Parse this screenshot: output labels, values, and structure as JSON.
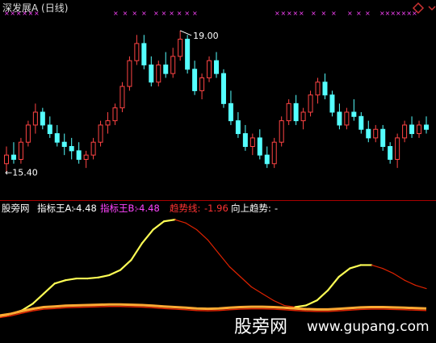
{
  "header": {
    "title": "深发展A (日线)",
    "icon": "diamond-icon",
    "icon_color": "#cc3333"
  },
  "price_panel": {
    "high_label": "19.00",
    "low_label": "←15.40"
  },
  "indicator_panel": {
    "name": "股旁网",
    "items": [
      {
        "label": "指标王A:",
        "value": "-4.48",
        "color": "#ffffff"
      },
      {
        "label": "指标王B:",
        "value": "-4.48",
        "color": "#ff44ff"
      },
      {
        "label": "趋势线:",
        "value": "-1.96",
        "color": "#ff3333"
      },
      {
        "label": "向上趋势:",
        "value": "-",
        "color": "#ffffff"
      }
    ]
  },
  "watermark": {
    "cn": "股旁网",
    "url": "www.gupang.com"
  },
  "colors": {
    "up": "#ff4444",
    "down": "#55ffff",
    "separator": "#aa0000",
    "marker": "#ff44ff",
    "yellow": "#ffff55",
    "red_line": "#dd2200",
    "orange": "#ffaa33"
  },
  "chart_data": {
    "type": "candlestick",
    "ylim": [
      15.2,
      19.3
    ],
    "candles": [
      [
        15.9,
        16.3,
        15.7,
        16.1
      ],
      [
        16.1,
        16.4,
        15.9,
        16.0
      ],
      [
        16.0,
        16.5,
        15.9,
        16.4
      ],
      [
        16.4,
        16.9,
        16.3,
        16.8
      ],
      [
        16.8,
        17.3,
        16.6,
        17.1
      ],
      [
        17.1,
        17.2,
        16.7,
        16.8
      ],
      [
        16.8,
        17.0,
        16.5,
        16.6
      ],
      [
        16.6,
        16.8,
        16.3,
        16.4
      ],
      [
        16.4,
        16.6,
        16.1,
        16.3
      ],
      [
        16.3,
        16.5,
        16.0,
        16.2
      ],
      [
        16.2,
        16.4,
        15.9,
        16.0
      ],
      [
        16.0,
        16.2,
        15.8,
        16.1
      ],
      [
        16.1,
        16.5,
        16.0,
        16.4
      ],
      [
        16.4,
        16.9,
        16.3,
        16.8
      ],
      [
        16.8,
        17.1,
        16.6,
        16.9
      ],
      [
        16.9,
        17.3,
        16.8,
        17.2
      ],
      [
        17.2,
        17.8,
        17.1,
        17.7
      ],
      [
        17.7,
        18.4,
        17.6,
        18.3
      ],
      [
        18.3,
        18.9,
        18.2,
        18.7
      ],
      [
        18.7,
        18.9,
        18.1,
        18.2
      ],
      [
        18.2,
        18.4,
        17.7,
        17.8
      ],
      [
        17.8,
        18.3,
        17.7,
        18.2
      ],
      [
        18.2,
        18.5,
        17.9,
        18.0
      ],
      [
        18.0,
        18.6,
        17.9,
        18.4
      ],
      [
        18.4,
        19.0,
        18.3,
        18.8
      ],
      [
        18.8,
        18.9,
        18.0,
        18.1
      ],
      [
        18.1,
        18.3,
        17.5,
        17.6
      ],
      [
        17.6,
        18.0,
        17.4,
        17.9
      ],
      [
        17.9,
        18.4,
        17.8,
        18.3
      ],
      [
        18.3,
        18.5,
        17.9,
        18.0
      ],
      [
        18.0,
        18.1,
        17.2,
        17.3
      ],
      [
        17.3,
        17.6,
        16.8,
        16.9
      ],
      [
        16.9,
        17.1,
        16.5,
        16.6
      ],
      [
        16.6,
        16.8,
        16.2,
        16.3
      ],
      [
        16.3,
        16.6,
        16.1,
        16.5
      ],
      [
        16.5,
        16.7,
        16.0,
        16.1
      ],
      [
        16.1,
        16.3,
        15.8,
        15.9
      ],
      [
        15.9,
        16.5,
        15.8,
        16.4
      ],
      [
        16.4,
        17.0,
        16.3,
        16.9
      ],
      [
        16.9,
        17.4,
        16.8,
        17.3
      ],
      [
        17.3,
        17.5,
        16.8,
        16.9
      ],
      [
        16.9,
        17.2,
        16.7,
        17.1
      ],
      [
        17.1,
        17.6,
        17.0,
        17.5
      ],
      [
        17.5,
        17.9,
        17.3,
        17.8
      ],
      [
        17.8,
        18.0,
        17.4,
        17.5
      ],
      [
        17.5,
        17.6,
        17.0,
        17.1
      ],
      [
        17.1,
        17.3,
        16.7,
        16.8
      ],
      [
        16.8,
        17.2,
        16.7,
        17.1
      ],
      [
        17.1,
        17.4,
        16.9,
        17.0
      ],
      [
        17.0,
        17.1,
        16.6,
        16.7
      ],
      [
        16.7,
        16.9,
        16.4,
        16.5
      ],
      [
        16.5,
        16.8,
        16.4,
        16.7
      ],
      [
        16.7,
        16.8,
        16.2,
        16.3
      ],
      [
        16.3,
        16.4,
        15.9,
        16.0
      ],
      [
        16.0,
        16.6,
        15.8,
        16.5
      ],
      [
        16.5,
        16.9,
        16.4,
        16.8
      ],
      [
        16.8,
        17.0,
        16.5,
        16.6
      ],
      [
        16.6,
        16.9,
        16.5,
        16.8
      ],
      [
        16.8,
        17.0,
        16.6,
        16.7
      ]
    ],
    "indicator": {
      "ylim": [
        -6,
        30
      ],
      "yellow": [
        0,
        1,
        2,
        4,
        7,
        10,
        11,
        11.5,
        11.5,
        11.8,
        12.5,
        14,
        17,
        22,
        26,
        28.5,
        29,
        28,
        26,
        23,
        19,
        15,
        12,
        9,
        7,
        5,
        3.5,
        3,
        3.5,
        5,
        8,
        12,
        14.5,
        15.5,
        15.5,
        14.5,
        13,
        11,
        9.5,
        8.5
      ],
      "red": [
        0,
        1,
        2,
        4,
        7,
        10,
        11,
        11.5,
        11.5,
        11.8,
        12.5,
        14,
        17,
        22,
        26,
        28.5,
        29,
        28,
        26,
        23,
        19,
        15,
        12,
        9,
        7,
        5,
        3.5,
        3,
        3.5,
        5,
        8,
        12,
        14.5,
        15.5,
        15.5,
        14.5,
        13,
        11,
        9.5,
        8.5
      ],
      "orange": [
        0.5,
        1,
        1.8,
        2.5,
        3,
        3.2,
        3.4,
        3.5,
        3.6,
        3.7,
        3.8,
        3.8,
        3.7,
        3.6,
        3.4,
        3.2,
        3,
        2.8,
        2.6,
        2.5,
        2.6,
        2.8,
        3,
        3.1,
        3.1,
        3,
        2.8,
        2.6,
        2.4,
        2.3,
        2.3,
        2.5,
        2.7,
        2.9,
        3,
        3,
        2.9,
        2.8,
        2.7,
        2.6
      ]
    }
  }
}
